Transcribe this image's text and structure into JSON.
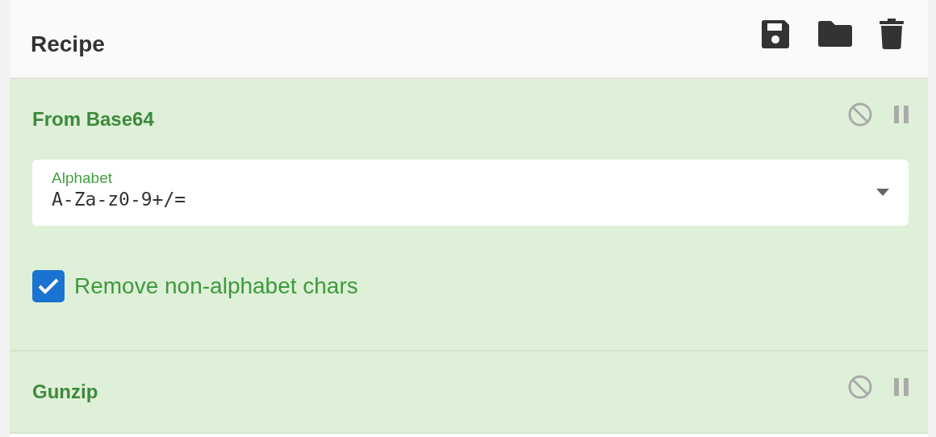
{
  "panel": {
    "title": "Recipe"
  },
  "operations": [
    {
      "name": "From Base64",
      "args": [
        {
          "kind": "select",
          "label": "Alphabet",
          "value": "A-Za-z0-9+/="
        },
        {
          "kind": "checkbox",
          "label": "Remove non-alphabet chars",
          "checked": true
        }
      ]
    },
    {
      "name": "Gunzip"
    }
  ]
}
